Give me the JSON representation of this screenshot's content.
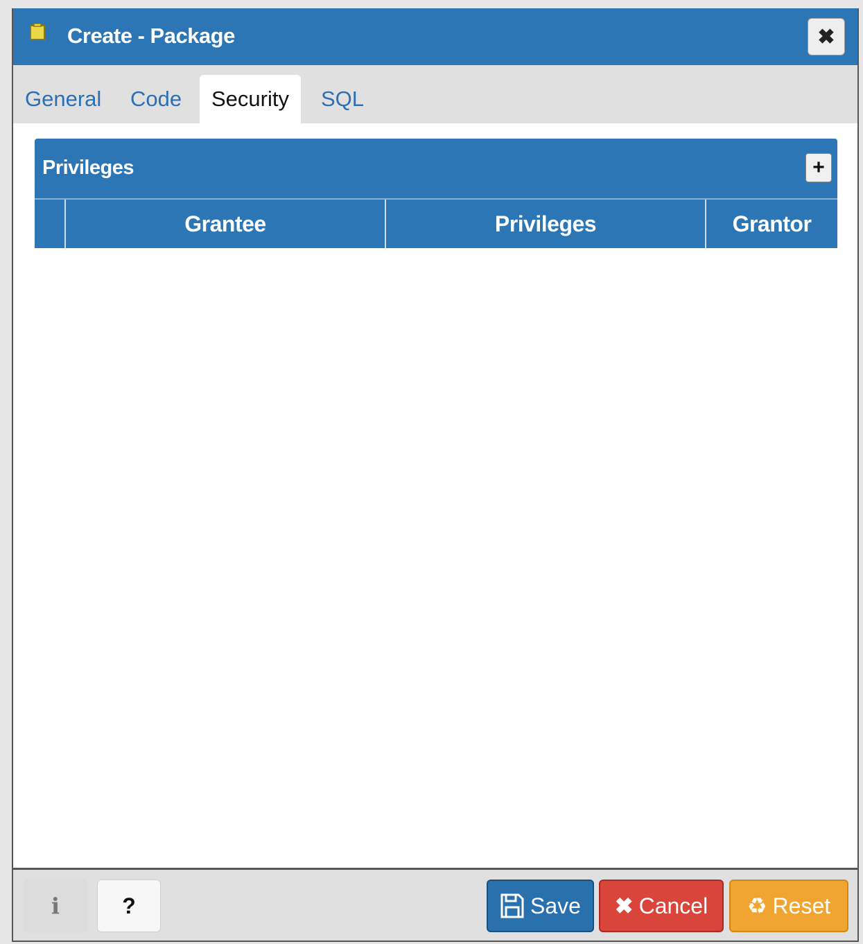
{
  "dialog": {
    "title": "Create - Package",
    "close_icon": "close-icon",
    "title_icon": "package-icon"
  },
  "tabs": [
    {
      "label": "General",
      "active": false
    },
    {
      "label": "Code",
      "active": false
    },
    {
      "label": "Security",
      "active": true
    },
    {
      "label": "SQL",
      "active": false
    }
  ],
  "privileges_panel": {
    "title": "Privileges",
    "add_icon": "plus-icon",
    "columns": [
      "Grantee",
      "Privileges",
      "Grantor"
    ],
    "rows": []
  },
  "footer": {
    "info_label": "i",
    "help_label": "?",
    "save_label": "Save",
    "cancel_label": "Cancel",
    "reset_label": "Reset"
  },
  "colors": {
    "header_blue": "#2c76b5",
    "save": "#2a70ad",
    "cancel": "#d9443b",
    "reset": "#f0a532"
  }
}
